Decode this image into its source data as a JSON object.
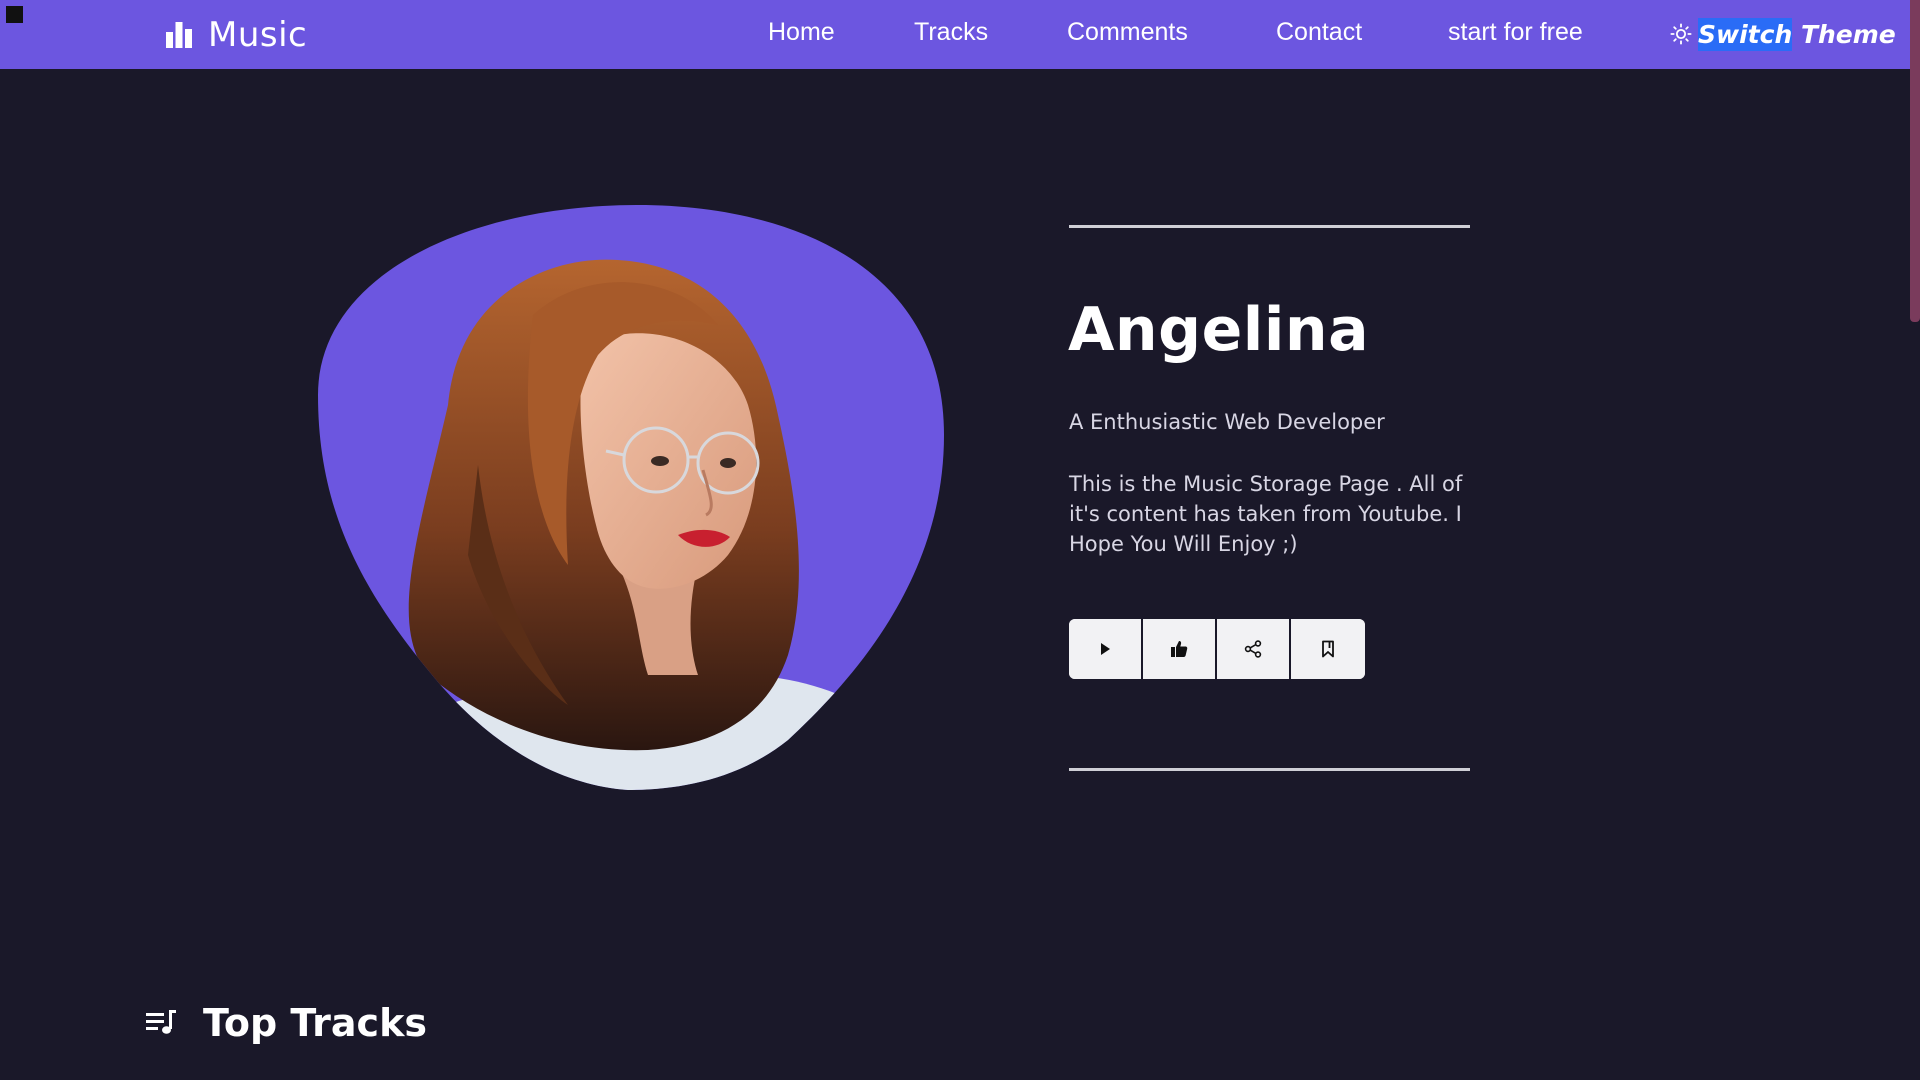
{
  "colors": {
    "accent": "#6c56e0",
    "background": "#1a1829",
    "selection": "#2a6cf6"
  },
  "navbar": {
    "brand": {
      "icon": "bar-chart-icon",
      "label": "Music"
    },
    "links": [
      {
        "label": "Home"
      },
      {
        "label": "Tracks"
      },
      {
        "label": "Comments"
      },
      {
        "label": "Contact"
      },
      {
        "label": "start for free"
      }
    ],
    "theme_switch": {
      "icon": "sun-icon",
      "label_selected": "Switch",
      "label_rest": " Theme"
    }
  },
  "hero": {
    "name": "Angelina",
    "role": "A Enthusiastic Web Developer",
    "description": "This is the Music Storage Page . All of it's content has taken from Youtube. I Hope You Will Enjoy ;)",
    "actions": [
      {
        "icon": "play-icon"
      },
      {
        "icon": "thumbs-up-icon"
      },
      {
        "icon": "share-icon"
      },
      {
        "icon": "bookmark-icon"
      }
    ]
  },
  "top_tracks": {
    "icon": "playlist-icon",
    "title": "Top Tracks"
  }
}
